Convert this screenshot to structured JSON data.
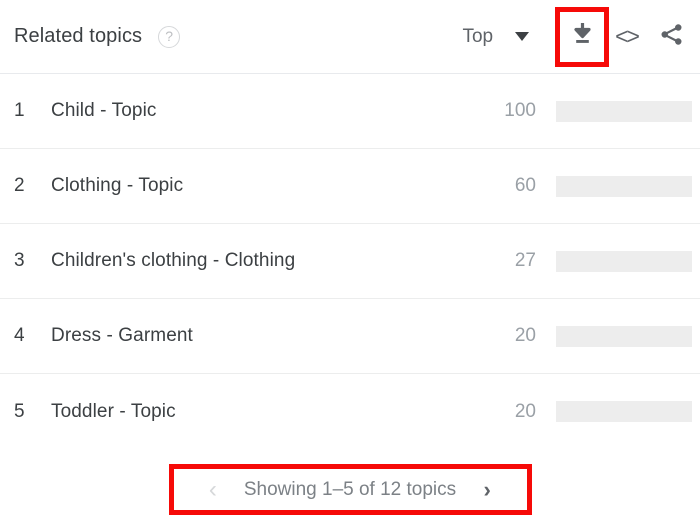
{
  "header": {
    "title": "Related topics",
    "help_icon": "question-mark-circle-icon",
    "sort_label": "Top",
    "dropdown_icon": "caret-down-icon",
    "download_icon": "download-icon",
    "embed_icon": "<>",
    "share_icon": "share-icon",
    "highlight_color": "#f60a08"
  },
  "chart_data": {
    "type": "bar",
    "title": "Related topics",
    "orientation": "horizontal",
    "xlabel": "",
    "ylabel": "",
    "ylim": [
      0,
      100
    ],
    "grid": false,
    "legend": null,
    "categories": [
      "Child - Topic",
      "Clothing - Topic",
      "Children's clothing - Clothing",
      "Dress - Garment",
      "Toddler - Topic"
    ],
    "values": [
      100,
      60,
      27,
      20,
      20
    ],
    "ranks": [
      1,
      2,
      3,
      4,
      5
    ],
    "bar_color": "#4285f4",
    "track_color": "#ededed"
  },
  "rows": [
    {
      "rank": "1",
      "topic": "Child - Topic",
      "value": "100",
      "pct": 100
    },
    {
      "rank": "2",
      "topic": "Clothing - Topic",
      "value": "60",
      "pct": 60
    },
    {
      "rank": "3",
      "topic": "Children's clothing - Clothing",
      "value": "27",
      "pct": 27
    },
    {
      "rank": "4",
      "topic": "Dress - Garment",
      "value": "20",
      "pct": 20
    },
    {
      "rank": "5",
      "topic": "Toddler - Topic",
      "value": "20",
      "pct": 20
    }
  ],
  "footer": {
    "prev_icon": "chevron-left-icon",
    "next_icon": "chevron-right-icon",
    "status": "Showing 1–5 of 12 topics"
  }
}
